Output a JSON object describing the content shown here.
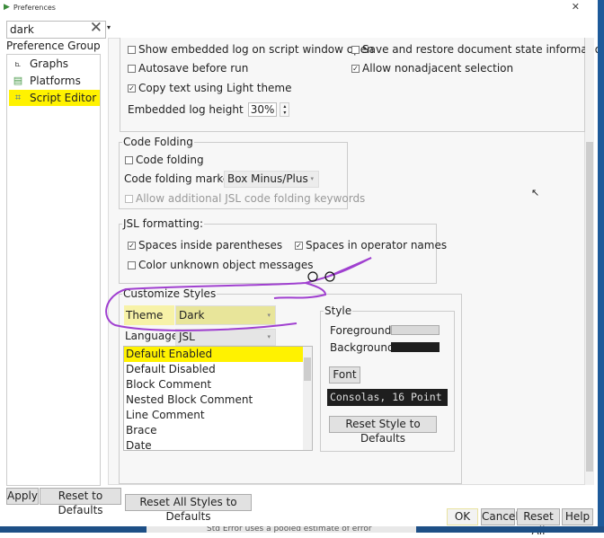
{
  "window": {
    "title": "Preferences"
  },
  "search": {
    "value": "dark"
  },
  "group": {
    "label": "Preference Group",
    "items": [
      {
        "label": "Graphs",
        "icon": "graph-icon"
      },
      {
        "label": "Platforms",
        "icon": "platform-icon"
      },
      {
        "label": "Script Editor",
        "icon": "script-editor-icon",
        "selected": true
      }
    ]
  },
  "top": {
    "show_log": "Show embedded log on script window open",
    "save_restore": "Save and restore document state information",
    "autosave": "Autosave before run",
    "nonadjacent": "Allow nonadjacent selection",
    "copy_light": "Copy text using Light theme",
    "log_height_label": "Embedded log height",
    "log_height_value": "30%"
  },
  "folding": {
    "title": "Code Folding",
    "code_folding": "Code folding",
    "marker_label": "Code folding marker",
    "marker_value": "Box Minus/Plus",
    "allow_keywords": "Allow additional JSL code folding keywords"
  },
  "jsl": {
    "title": "JSL formatting:",
    "spaces_paren": "Spaces inside parentheses",
    "spaces_op": "Spaces in operator names",
    "color_unknown": "Color unknown object messages"
  },
  "styles": {
    "title": "Customize Styles",
    "theme_label": "Theme",
    "theme_value": "Dark",
    "language_label": "Language",
    "language_value": "JSL",
    "items": [
      "Default Enabled",
      "Default Disabled",
      "Block Comment",
      "Nested Block Comment",
      "Line Comment",
      "Brace",
      "Date"
    ],
    "reset_all": "Reset All Styles to Defaults"
  },
  "style": {
    "title": "Style",
    "foreground_label": "Foreground",
    "foreground_color": "#d9d9d9",
    "background_label": "Background",
    "background_color": "#1e1e1e",
    "font_button": "Font",
    "font_value": "Consolas, 16 Point",
    "reset_style": "Reset Style to Defaults"
  },
  "footer": {
    "apply": "Apply",
    "reset_defaults": "Reset to Defaults",
    "ok": "OK",
    "cancel": "Cancel",
    "reset_all": "Reset All",
    "help": "Help"
  },
  "background_doc": {
    "text": "Std Error uses a pooled estimate of error"
  },
  "colors": {
    "highlight": "#fff200",
    "annotation": "#a040d0"
  }
}
